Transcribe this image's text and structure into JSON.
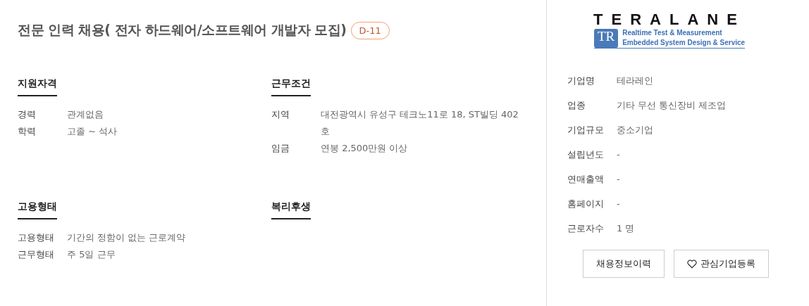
{
  "title": "전문 인력 채용( 전자 하드웨어/소프트웨어 개발자 모집)",
  "dday": "D-11",
  "sections": [
    {
      "heading": "지원자격",
      "rows": [
        {
          "label": "경력",
          "value": "관계없음"
        },
        {
          "label": "학력",
          "value": "고졸 ~ 석사"
        }
      ]
    },
    {
      "heading": "근무조건",
      "rows": [
        {
          "label": "지역",
          "value": "대전광역시 유성구 테크노11로 18, ST빌딩 402호"
        },
        {
          "label": "임금",
          "value": "연봉 2,500만원 이상"
        }
      ]
    },
    {
      "heading": "고용형태",
      "rows": [
        {
          "label": "고용형태",
          "value": "기간의 정함이 없는 근로계약"
        },
        {
          "label": "근무형태",
          "value": "주 5일 근무"
        }
      ]
    },
    {
      "heading": "복리후생"
    }
  ],
  "company": {
    "logo": {
      "name": "TERALANE",
      "mark": "TR",
      "line1": "Realtime Test & Measurement",
      "line2": "Embedded System Design & Service"
    },
    "rows": [
      {
        "label": "기업명",
        "value": "테라레인"
      },
      {
        "label": "업종",
        "value": "기타 무선 통신장비 제조업"
      },
      {
        "label": "기업규모",
        "value": "중소기업"
      },
      {
        "label": "설립년도",
        "value": "-"
      },
      {
        "label": "연매출액",
        "value": "-"
      },
      {
        "label": "홈페이지",
        "value": "-"
      },
      {
        "label": "근로자수",
        "value": "1 명"
      }
    ],
    "buttons": [
      {
        "label": "채용정보이력",
        "kind": "plain"
      },
      {
        "label": "관심기업등록",
        "kind": "heart"
      }
    ]
  }
}
